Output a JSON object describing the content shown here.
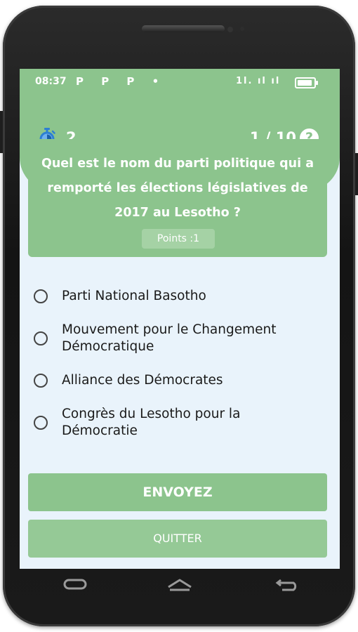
{
  "status_bar": {
    "time": "08:37",
    "app_icons": "P P P •",
    "signal": "1l. ıl ıl"
  },
  "header": {
    "timer_value": "2",
    "progress": "1 / 10",
    "help_icon": "question-mark-icon"
  },
  "question": {
    "text": "Quel est le nom du parti politique qui a remporté les élections législatives de 2017 au Lesotho ?",
    "points_label": "Points :1"
  },
  "options": [
    {
      "label": "Parti National Basotho"
    },
    {
      "label": "Mouvement pour le Changement Démocratique"
    },
    {
      "label": "Alliance des Démocrates"
    },
    {
      "label": "Congrès du Lesotho pour la Démocratie"
    }
  ],
  "buttons": {
    "submit": "ENVOYEZ",
    "quit": "QUITTER"
  },
  "nav": {
    "recent": "recent-apps-icon",
    "home": "home-icon",
    "back": "back-icon"
  },
  "colors": {
    "accent": "#8cc48d",
    "background": "#e9f3fb",
    "timer_icon": "#2d7fd3"
  }
}
